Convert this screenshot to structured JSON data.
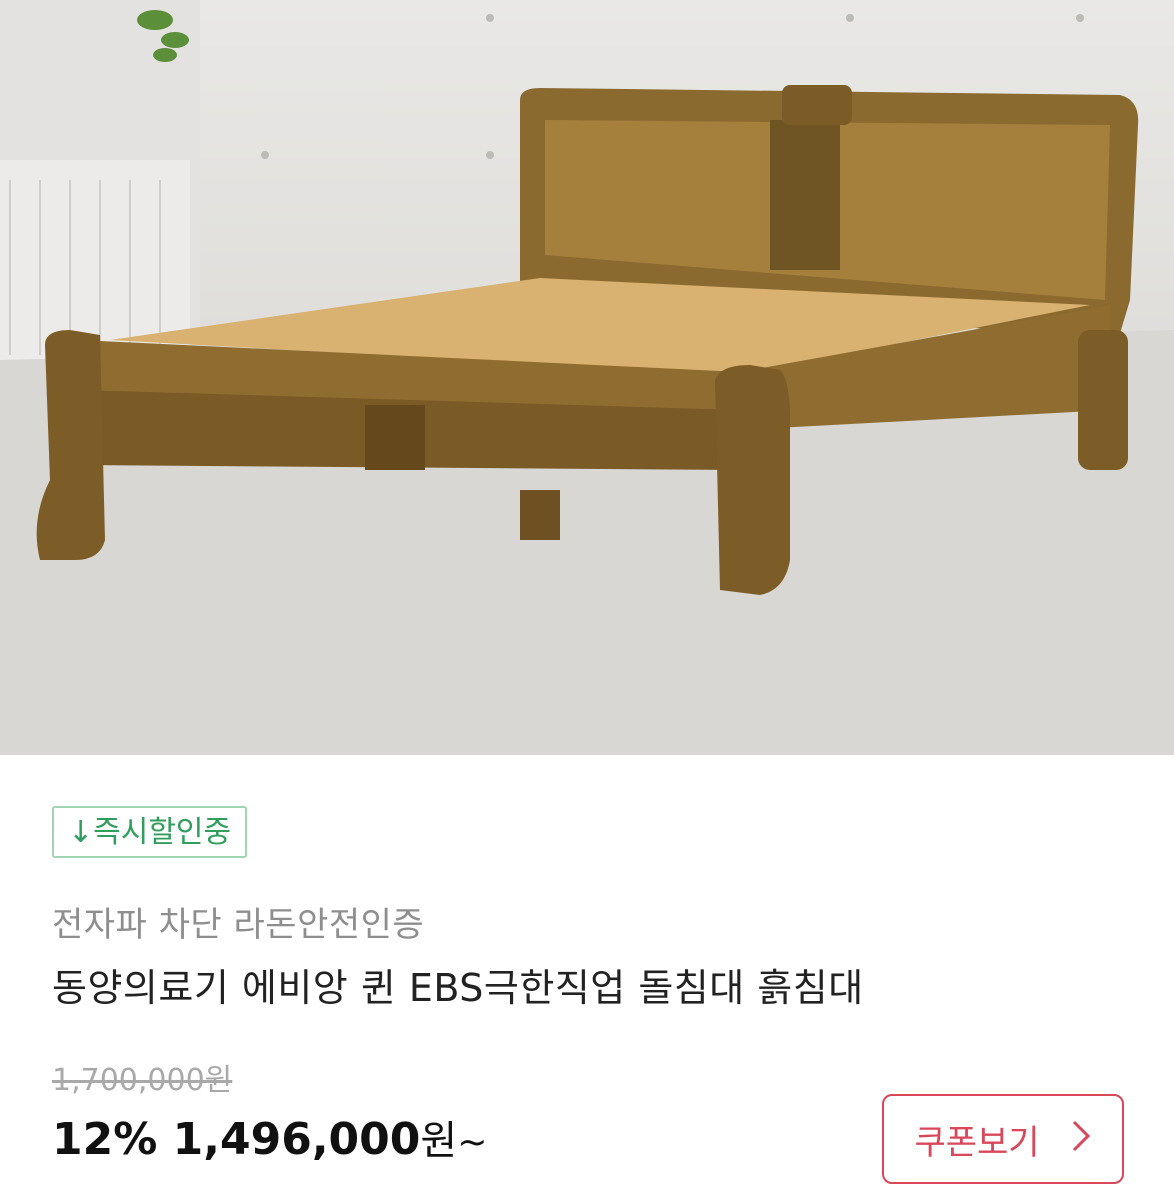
{
  "product": {
    "image_alt": "wooden sleigh bed",
    "badge": "↓즉시할인중",
    "subtitle": "전자파 차단 라돈안전인증",
    "title": "동양의료기 에비앙 퀸 EBS극한직업 돌침대 흙침대",
    "original_price": "1,700,000원",
    "discount_percent": "12%",
    "price": "1,496,000",
    "price_unit": "원",
    "price_suffix": "~"
  },
  "actions": {
    "coupon_label": "쿠폰보기",
    "coupon_icon": "chevron-right-icon"
  },
  "colors": {
    "badge_green": "#2f9e5c",
    "coupon_red": "#d9475a"
  }
}
